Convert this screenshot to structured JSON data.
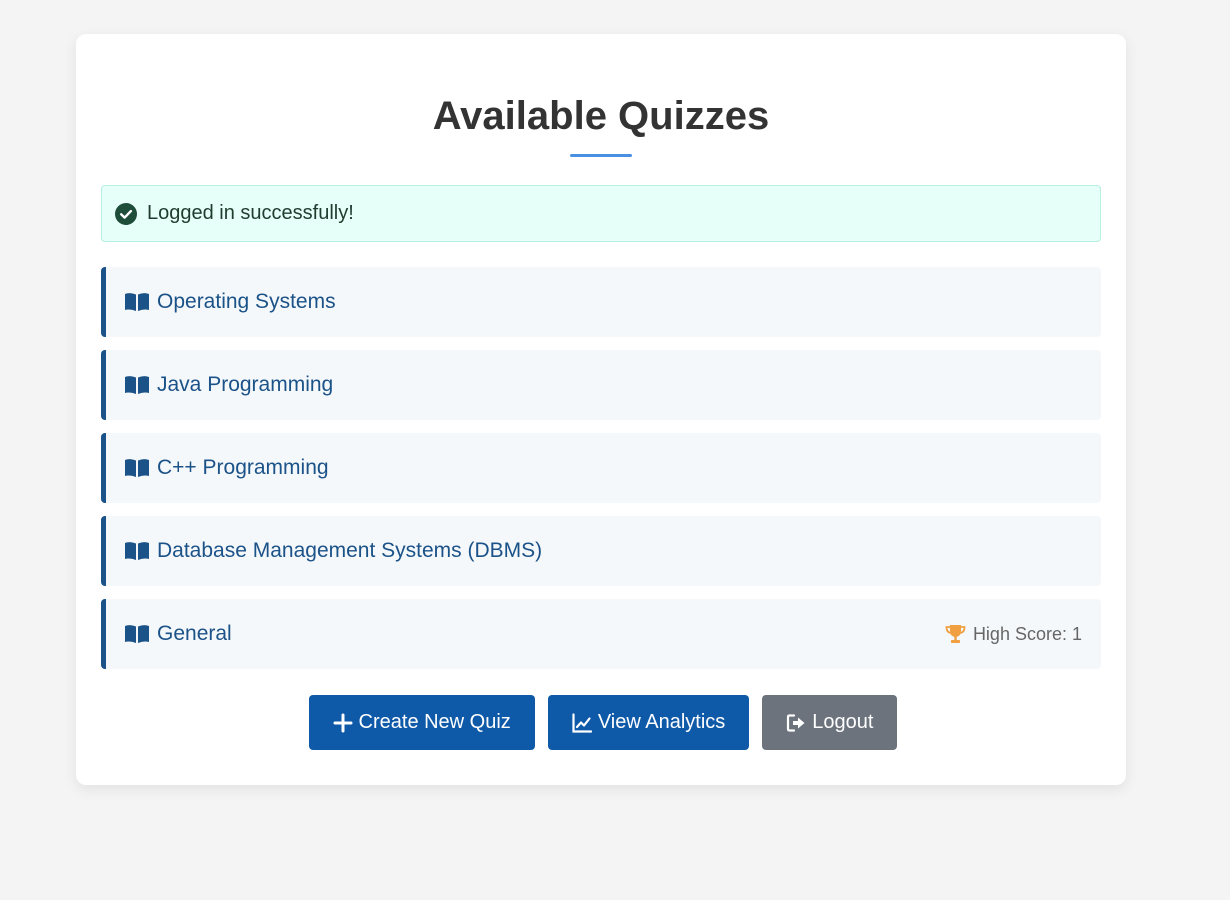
{
  "page": {
    "title": "Available Quizzes"
  },
  "alert": {
    "message": "Logged in successfully!",
    "icon": "check-circle-icon",
    "color": "#1e3d2f",
    "background": "#e6fff8"
  },
  "quizzes": [
    {
      "title": "Operating Systems",
      "icon": "book-icon"
    },
    {
      "title": "Java Programming",
      "icon": "book-icon"
    },
    {
      "title": "C++ Programming",
      "icon": "book-icon"
    },
    {
      "title": "Database Management Systems (DBMS)",
      "icon": "book-icon"
    },
    {
      "title": "General",
      "icon": "book-icon",
      "high_score_label": "High Score: 1",
      "high_score_icon": "trophy-icon"
    }
  ],
  "actions": {
    "create_label": "Create New Quiz",
    "create_icon": "plus-icon",
    "analytics_label": "View Analytics",
    "analytics_icon": "chart-line-icon",
    "logout_label": "Logout",
    "logout_icon": "sign-out-icon"
  },
  "colors": {
    "accent": "#4a90e2",
    "primary": "#0f5aa8",
    "quiz_text": "#1b5288",
    "secondary": "#6c737d",
    "trophy": "#f0a040"
  }
}
